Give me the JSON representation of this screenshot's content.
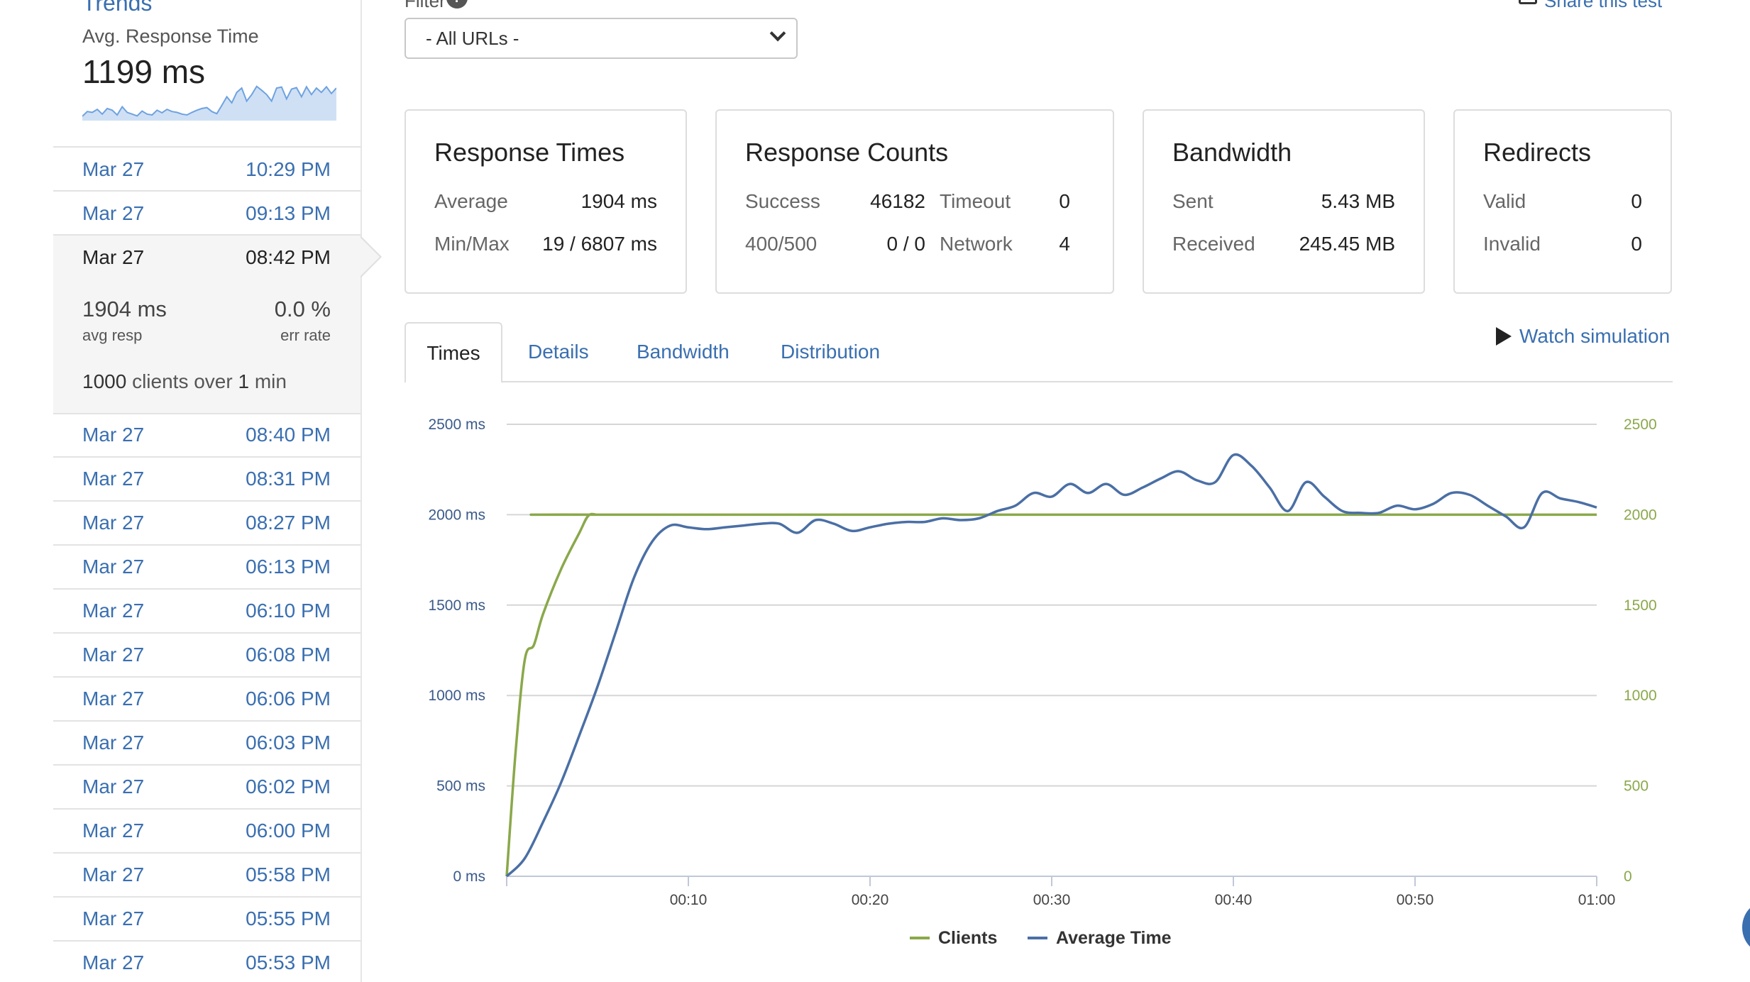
{
  "sidebar": {
    "trends_title": "Trends",
    "metric_label": "Avg. Response Time",
    "metric_value": "1199 ms",
    "runs_before": [
      {
        "date": "Mar 27",
        "time": "10:29 PM"
      },
      {
        "date": "Mar 27",
        "time": "09:13 PM"
      }
    ],
    "active_run": {
      "date": "Mar 27",
      "time": "08:42 PM",
      "avg_resp_value": "1904 ms",
      "avg_resp_label": "avg resp",
      "err_rate_value": "0.0 %",
      "err_rate_label": "err rate",
      "clients_count": "1000",
      "clients_text": " clients over ",
      "duration_count": "1",
      "duration_unit": " min"
    },
    "runs_after": [
      {
        "date": "Mar 27",
        "time": "08:40 PM"
      },
      {
        "date": "Mar 27",
        "time": "08:31 PM"
      },
      {
        "date": "Mar 27",
        "time": "08:27 PM"
      },
      {
        "date": "Mar 27",
        "time": "06:13 PM"
      },
      {
        "date": "Mar 27",
        "time": "06:10 PM"
      },
      {
        "date": "Mar 27",
        "time": "06:08 PM"
      },
      {
        "date": "Mar 27",
        "time": "06:06 PM"
      },
      {
        "date": "Mar 27",
        "time": "06:03 PM"
      },
      {
        "date": "Mar 27",
        "time": "06:02 PM"
      },
      {
        "date": "Mar 27",
        "time": "06:00 PM"
      },
      {
        "date": "Mar 27",
        "time": "05:58 PM"
      },
      {
        "date": "Mar 27",
        "time": "05:55 PM"
      },
      {
        "date": "Mar 27",
        "time": "05:53 PM"
      }
    ],
    "sparkline": [
      200,
      420,
      380,
      520,
      300,
      560,
      480,
      260,
      640,
      380,
      300,
      220,
      440,
      300,
      260,
      480,
      360,
      520,
      420,
      380,
      300,
      260,
      380,
      480,
      560,
      600,
      420,
      320,
      700,
      1100,
      820,
      1300,
      1500,
      900,
      1200,
      1580,
      1400,
      1200,
      900,
      1500,
      1550,
      1000,
      1450,
      1520,
      1100,
      1560,
      1200,
      1500,
      1300,
      1560,
      1250,
      1500
    ]
  },
  "header": {
    "filter_label": "Filter",
    "url_select_value": "- All URLs -",
    "share_label": "Share this test"
  },
  "cards": {
    "response_times": {
      "title": "Response Times",
      "average_label": "Average",
      "average_value": "1904 ms",
      "minmax_label": "Min/Max",
      "minmax_value": "19 / 6807 ms"
    },
    "response_counts": {
      "title": "Response Counts",
      "success_label": "Success",
      "success_value": "46182",
      "timeout_label": "Timeout",
      "timeout_value": "0",
      "err_label": "400/500",
      "err_value": "0 / 0",
      "network_label": "Network",
      "network_value": "4"
    },
    "bandwidth": {
      "title": "Bandwidth",
      "sent_label": "Sent",
      "sent_value": "5.43 MB",
      "received_label": "Received",
      "received_value": "245.45 MB"
    },
    "redirects": {
      "title": "Redirects",
      "valid_label": "Valid",
      "valid_value": "0",
      "invalid_label": "Invalid",
      "invalid_value": "0"
    }
  },
  "tabs": {
    "times": "Times",
    "details": "Details",
    "bandwidth": "Bandwidth",
    "distribution": "Distribution",
    "watch": "Watch simulation"
  },
  "colors": {
    "link": "#3a6fb0",
    "clients": "#8aa84a",
    "average": "#4a6fa5",
    "grid": "#d6d6d6"
  },
  "chart_data": {
    "type": "line",
    "xlabel": "",
    "ylabel_left": "",
    "ylabel_right": "",
    "x_range": [
      0,
      60
    ],
    "y_range_left": [
      0,
      2500
    ],
    "y_range_right": [
      0,
      2500
    ],
    "x_ticks": [
      "00:10",
      "00:20",
      "00:30",
      "00:40",
      "00:50",
      "01:00"
    ],
    "y_ticks_left": [
      "0 ms",
      "500 ms",
      "1000 ms",
      "1500 ms",
      "2000 ms",
      "2500 ms"
    ],
    "y_ticks_right": [
      "0",
      "500",
      "1000",
      "1500",
      "2000",
      "2500"
    ],
    "grid": true,
    "legend_position": "bottom",
    "series": [
      {
        "name": "Clients",
        "axis": "right",
        "x": [
          0,
          0.5,
          1,
          1.5,
          2,
          3,
          4,
          4.5,
          5,
          5.5,
          60
        ],
        "y": [
          0,
          700,
          1200,
          1280,
          1450,
          1700,
          1900,
          1995,
          2000,
          2000,
          2000
        ]
      },
      {
        "name": "Average Time",
        "axis": "left",
        "x": [
          0,
          1,
          2,
          3,
          4,
          5,
          6,
          7,
          8,
          9,
          10,
          11,
          12,
          13,
          14,
          15,
          16,
          17,
          18,
          19,
          20,
          21,
          22,
          23,
          24,
          25,
          26,
          27,
          28,
          29,
          30,
          31,
          32,
          33,
          34,
          35,
          36,
          37,
          38,
          39,
          40,
          41,
          42,
          43,
          44,
          45,
          46,
          47,
          48,
          49,
          50,
          51,
          52,
          53,
          54,
          55,
          56,
          57,
          58,
          59,
          60
        ],
        "y": [
          0,
          100,
          300,
          520,
          780,
          1050,
          1350,
          1650,
          1850,
          1940,
          1930,
          1920,
          1930,
          1940,
          1950,
          1950,
          1900,
          1970,
          1950,
          1910,
          1930,
          1950,
          1960,
          1960,
          1980,
          1970,
          1980,
          2020,
          2050,
          2120,
          2100,
          2170,
          2120,
          2170,
          2110,
          2150,
          2200,
          2240,
          2190,
          2180,
          2330,
          2270,
          2150,
          2020,
          2180,
          2100,
          2020,
          2010,
          2010,
          2050,
          2030,
          2060,
          2120,
          2110,
          2050,
          1990,
          1930,
          2120,
          2090,
          2070,
          2040
        ]
      }
    ]
  }
}
